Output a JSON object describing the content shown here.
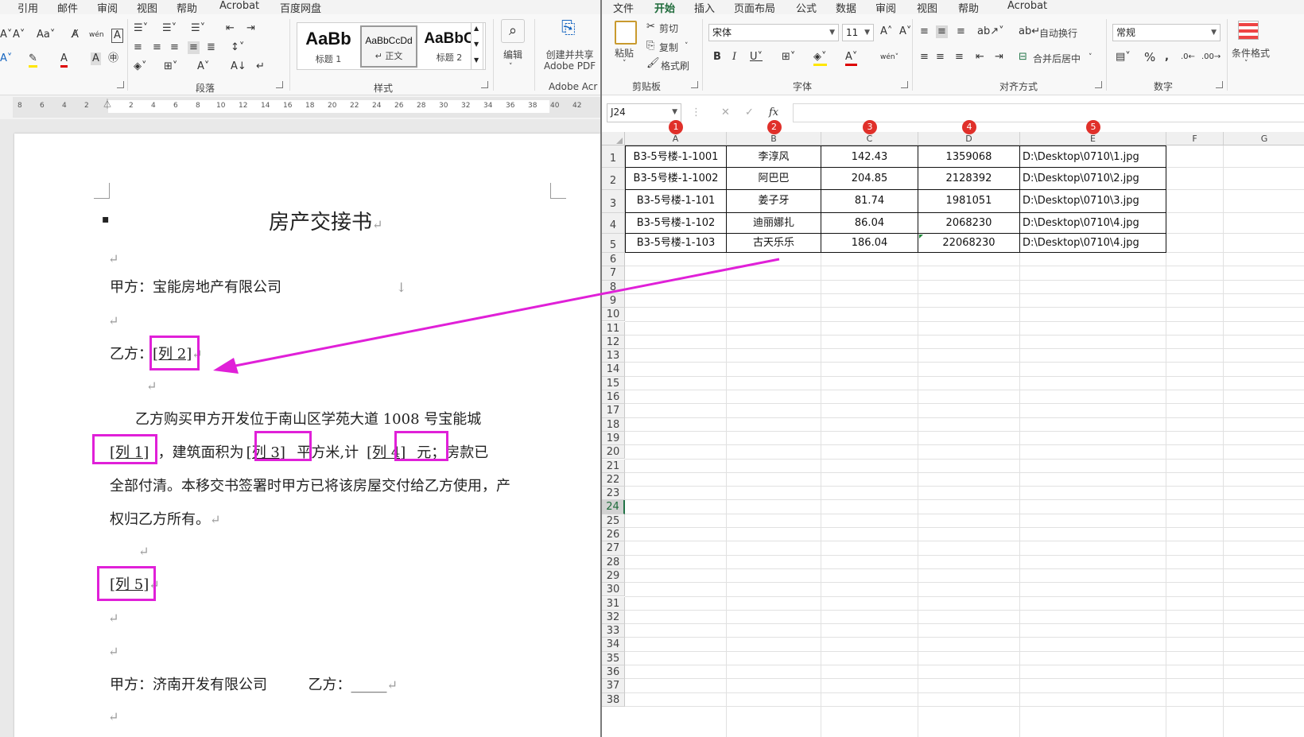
{
  "word": {
    "menu_tabs": [
      "引用",
      "邮件",
      "审阅",
      "视图",
      "帮助",
      "Acrobat",
      "百度网盘"
    ],
    "ribbon": {
      "group_paragraph": "段落",
      "group_styles": "样式",
      "styles": [
        {
          "preview": "AaBb",
          "caption": "标题 1"
        },
        {
          "preview": "AaBbCcDd",
          "caption": "↵ 正文"
        },
        {
          "preview": "AaBbC",
          "caption": "标题 2"
        }
      ],
      "edit_label": "编辑",
      "create_pdf_label": "创建并共享\nAdobe PDF",
      "adobe_label": "Adobe Acr"
    },
    "ruler_left": [
      "8",
      "6",
      "4",
      "2"
    ],
    "ruler_right": [
      "2",
      "4",
      "6",
      "8",
      "10",
      "12",
      "14",
      "16",
      "18",
      "20",
      "22",
      "24",
      "26",
      "28",
      "30",
      "32",
      "34",
      "36",
      "38",
      "40",
      "42"
    ],
    "document": {
      "title": "房产交接书",
      "party_a_label": "甲方：",
      "party_a": "宝能房地产有限公司",
      "party_b_label": "乙方：",
      "party_b_field": "[列 2]",
      "body_line1": "乙方购买甲方开发位于南山区学苑大道 1008 号宝能城",
      "field_col1": "[列 1]",
      "text_area_pre": "，建筑面积为",
      "field_col3": "[列 3]",
      "text_sqm": "平方米,计",
      "field_col4": "[列 4]",
      "text_yuan": "元；房款已",
      "body_line3": "全部付清。本移交书签署时甲方已将该房屋交付给乙方使用，产",
      "body_line4": "权归乙方所有。",
      "field_col5": "[列 5]",
      "sign_a_label": "甲方：",
      "sign_a": "济南开发有限公司",
      "sign_b_label": "乙方：",
      "sign_b_blank": "_____"
    }
  },
  "excel": {
    "menu_tabs": [
      "文件",
      "开始",
      "插入",
      "页面布局",
      "公式",
      "数据",
      "审阅",
      "视图",
      "帮助",
      "Acrobat"
    ],
    "active_tab": "开始",
    "ribbon": {
      "paste_label": "粘贴",
      "cut_label": "剪切",
      "copy_label": "复制",
      "format_painter_label": "格式刷",
      "clipboard_group": "剪贴板",
      "font_name": "宋体",
      "font_size": "11",
      "font_group": "字体",
      "wrap_text_label": "自动换行",
      "merge_center_label": "合并后居中",
      "alignment_group": "对齐方式",
      "number_format": "常规",
      "number_group": "数字",
      "conditional_format_label": "条件格式"
    },
    "name_box": "J24",
    "formula_value": "",
    "columns": [
      "A",
      "B",
      "C",
      "D",
      "E",
      "F",
      "G"
    ],
    "badges": [
      "1",
      "2",
      "3",
      "4",
      "5"
    ],
    "active_row": 24,
    "rows_visible": 38,
    "table": [
      [
        "B3-5号楼-1-1001",
        "李淳风",
        "142.43",
        "1359068",
        "D:\\Desktop\\0710\\1.jpg"
      ],
      [
        "B3-5号楼-1-1002",
        "阿巴巴",
        "204.85",
        "2128392",
        "D:\\Desktop\\0710\\2.jpg"
      ],
      [
        "B3-5号楼-1-101",
        "姜子牙",
        "81.74",
        "1981051",
        "D:\\Desktop\\0710\\3.jpg"
      ],
      [
        "B3-5号楼-1-102",
        "迪丽娜扎",
        "86.04",
        "2068230",
        "D:\\Desktop\\0710\\4.jpg"
      ],
      [
        "B3-5号楼-1-103",
        "古天乐乐",
        "186.04",
        "22068230",
        "D:\\Desktop\\0710\\4.jpg"
      ]
    ]
  },
  "colors": {
    "highlight": "#e020d8",
    "excel_green": "#217346",
    "badge_red": "#e0302a"
  }
}
